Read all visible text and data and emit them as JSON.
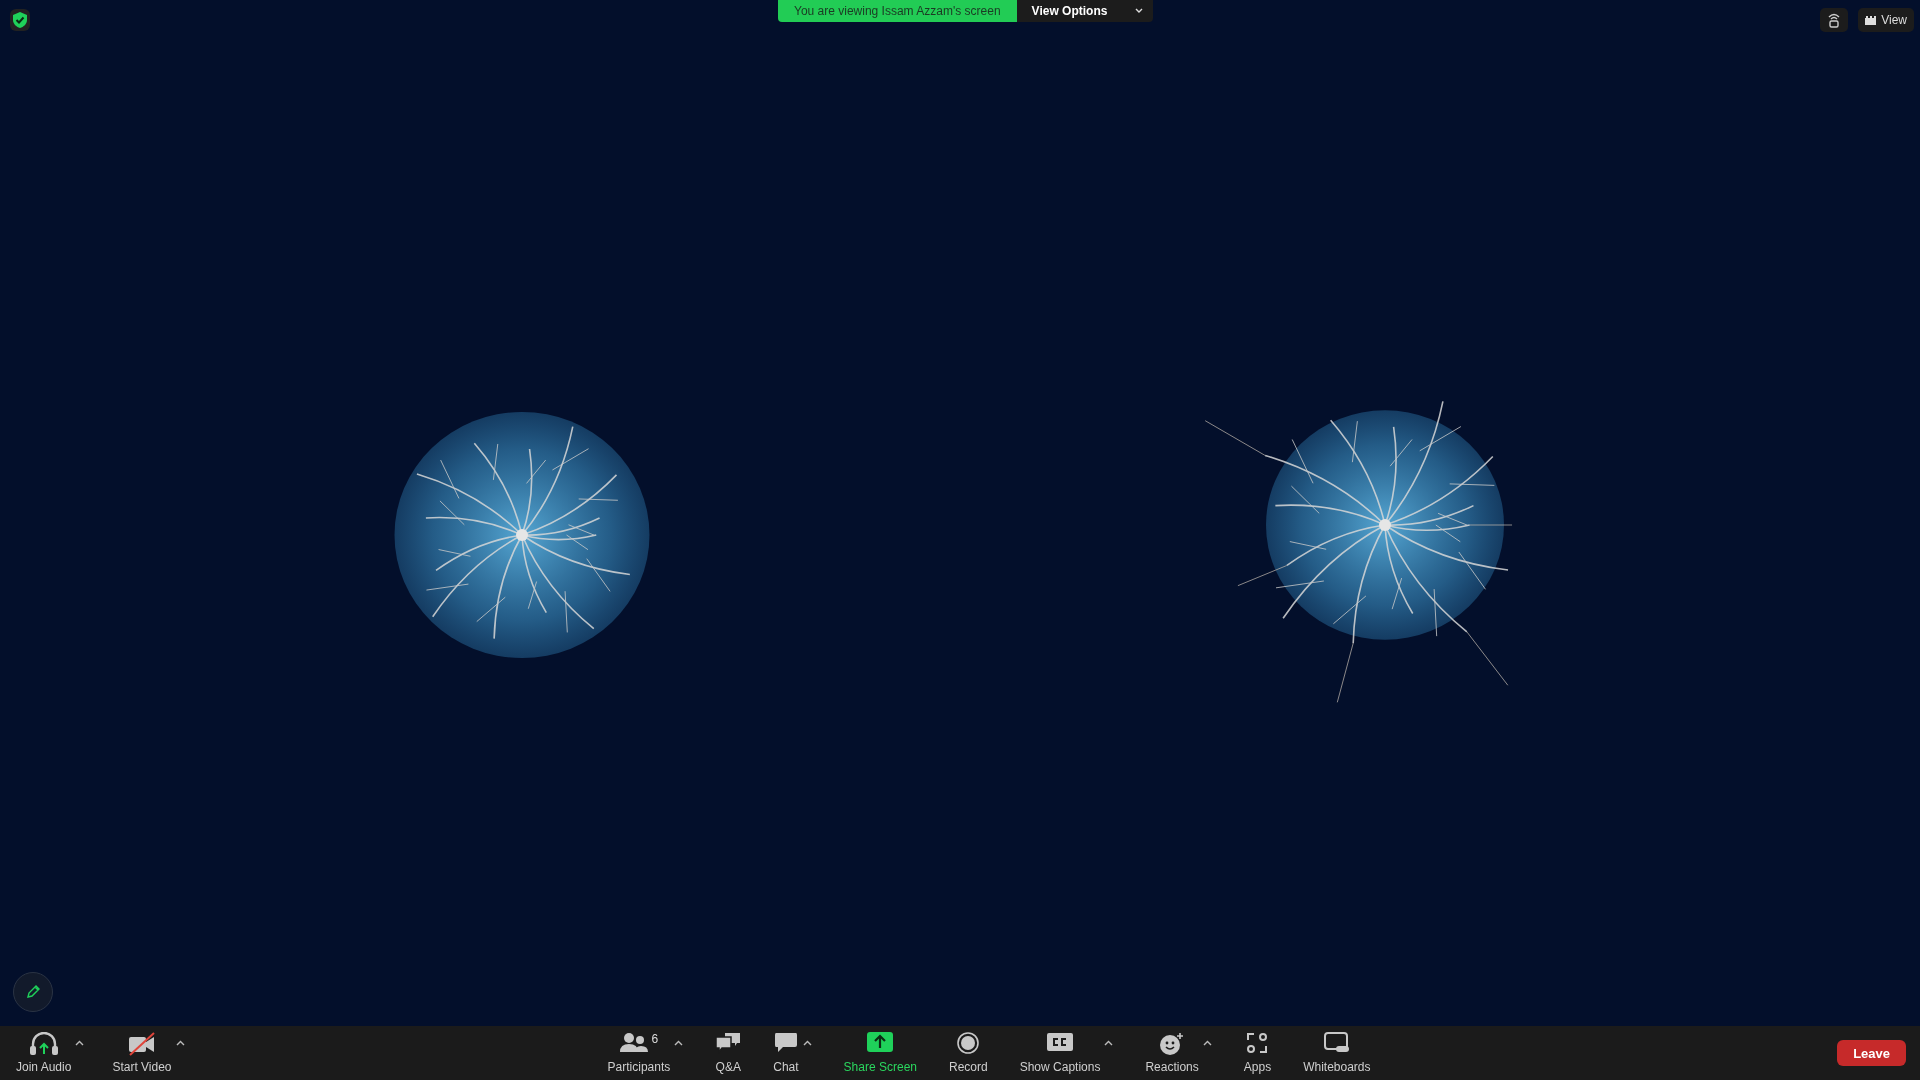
{
  "top_banner": {
    "message": "You are viewing Issam Azzam's screen",
    "options_button": "View Options"
  },
  "top_right": {
    "view_button": "View"
  },
  "toolbar": {
    "left_items": [
      {
        "kind": "audio",
        "label": "Join Audio",
        "caret": true
      },
      {
        "kind": "video",
        "label": "Start Video",
        "caret": true
      }
    ],
    "center_items": [
      {
        "kind": "participants",
        "label": "Participants",
        "badge": "6",
        "caret": true
      },
      {
        "kind": "qa",
        "label": "Q&A",
        "caret": false
      },
      {
        "kind": "chat",
        "label": "Chat",
        "caret": true
      },
      {
        "kind": "share",
        "label": "Share Screen",
        "caret": false
      },
      {
        "kind": "record",
        "label": "Record",
        "caret": false
      },
      {
        "kind": "captions",
        "label": "Show Captions",
        "caret": true
      },
      {
        "kind": "reactions",
        "label": "Reactions",
        "caret": true
      },
      {
        "kind": "apps",
        "label": "Apps",
        "caret": false
      },
      {
        "kind": "whiteboards",
        "label": "Whiteboards",
        "caret": false
      }
    ],
    "leave_button": "Leave"
  }
}
